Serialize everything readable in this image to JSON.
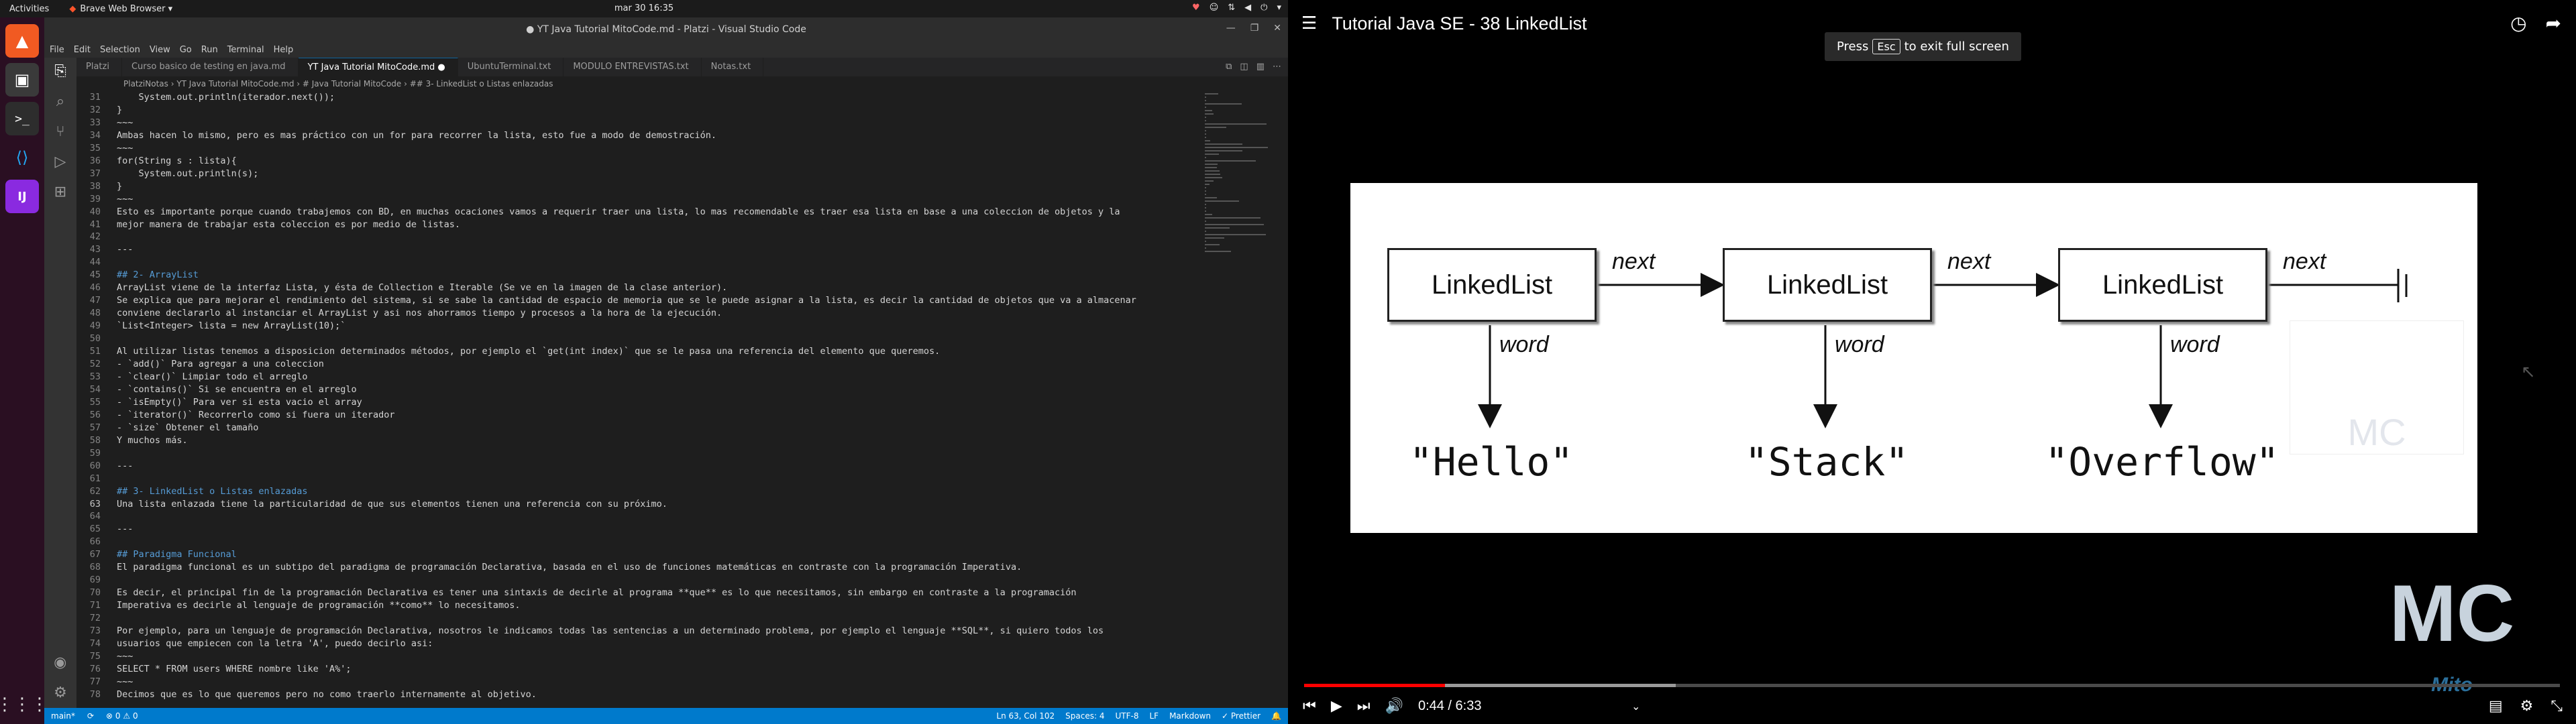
{
  "topbar": {
    "activities": "Activities",
    "app": "Brave Web Browser ▾",
    "clock": "mar 30  16:35"
  },
  "vscode": {
    "title": "● YT Java Tutorial MitoCode.md - Platzi - Visual Studio Code",
    "menu": [
      "File",
      "Edit",
      "Selection",
      "View",
      "Go",
      "Run",
      "Terminal",
      "Help"
    ],
    "tabs": [
      {
        "label": "Platzi",
        "active": false
      },
      {
        "label": "Curso basico de testing en java.md",
        "active": false
      },
      {
        "label": "YT Java Tutorial MitoCode.md ●",
        "active": true
      },
      {
        "label": "UbuntuTerminal.txt",
        "active": false
      },
      {
        "label": "MODULO ENTREVISTAS.txt",
        "active": false
      },
      {
        "label": "Notas.txt",
        "active": false
      }
    ],
    "breadcrumb": "PlatziNotas  ›  YT Java Tutorial MitoCode.md  ›  # Java Tutorial MitoCode  ›  ## 3- LinkedList o Listas enlazadas",
    "lines": [
      {
        "n": "31",
        "t": "    System.out.println(iterador.next());"
      },
      {
        "n": "32",
        "t": "}"
      },
      {
        "n": "33",
        "t": "~~~"
      },
      {
        "n": "34",
        "t": "Ambas hacen lo mismo, pero es mas práctico con un for para recorrer la lista, esto fue a modo de demostración."
      },
      {
        "n": "35",
        "t": "~~~"
      },
      {
        "n": "36",
        "t": "for(String s : lista){"
      },
      {
        "n": "37",
        "t": "    System.out.println(s);"
      },
      {
        "n": "38",
        "t": "}"
      },
      {
        "n": "39",
        "t": "~~~"
      },
      {
        "n": "40",
        "t": "Esto es importante porque cuando trabajemos con BD, en muchas ocaciones vamos a requerir traer una lista, lo mas recomendable es traer esa lista en base a una coleccion de objetos y la"
      },
      {
        "n": "41",
        "t": "mejor manera de trabajar esta coleccion es por medio de listas."
      },
      {
        "n": "42",
        "t": ""
      },
      {
        "n": "43",
        "t": "---"
      },
      {
        "n": "44",
        "t": ""
      },
      {
        "n": "45",
        "t": "## 2- ArrayList"
      },
      {
        "n": "46",
        "t": "ArrayList viene de la interfaz Lista, y ésta de Collection e Iterable (Se ve en la imagen de la clase anterior)."
      },
      {
        "n": "47",
        "t": "Se explica que para mejorar el rendimiento del sistema, si se sabe la cantidad de espacio de memoria que se le puede asignar a la lista, es decir la cantidad de objetos que va a almacenar"
      },
      {
        "n": "48",
        "t": "conviene declararlo al instanciar el ArrayList y asi nos ahorramos tiempo y procesos a la hora de la ejecución."
      },
      {
        "n": "49",
        "t": "`List<Integer> lista = new ArrayList(10);`"
      },
      {
        "n": "50",
        "t": ""
      },
      {
        "n": "51",
        "t": "Al utilizar listas tenemos a disposicion determinados métodos, por ejemplo el `get(int index)` que se le pasa una referencia del elemento que queremos."
      },
      {
        "n": "52",
        "t": "- `add()` Para agregar a una coleccion"
      },
      {
        "n": "53",
        "t": "- `clear()` Limpiar todo el arreglo"
      },
      {
        "n": "54",
        "t": "- `contains()` Si se encuentra en el arreglo"
      },
      {
        "n": "55",
        "t": "- `isEmpty()` Para ver si esta vacio el array"
      },
      {
        "n": "56",
        "t": "- `iterator()` Recorrerlo como si fuera un iterador"
      },
      {
        "n": "57",
        "t": "- `size` Obtener el tamaño"
      },
      {
        "n": "58",
        "t": "Y muchos más."
      },
      {
        "n": "59",
        "t": ""
      },
      {
        "n": "60",
        "t": "---"
      },
      {
        "n": "61",
        "t": ""
      },
      {
        "n": "62",
        "t": "## 3- LinkedList o Listas enlazadas"
      },
      {
        "n": "63",
        "t": "Una lista enlazada tiene la particularidad de que sus elementos tienen una referencia con su próximo."
      },
      {
        "n": "64",
        "t": ""
      },
      {
        "n": "65",
        "t": "---"
      },
      {
        "n": "66",
        "t": ""
      },
      {
        "n": "67",
        "t": "## Paradigma Funcional"
      },
      {
        "n": "68",
        "t": "El paradigma funcional es un subtipo del paradigma de programación Declarativa, basada en el uso de funciones matemáticas en contraste con la programación Imperativa."
      },
      {
        "n": "69",
        "t": ""
      },
      {
        "n": "70",
        "t": "Es decir, el principal fin de la programación Declarativa es tener una sintaxis de decirle al programa **que** es lo que necesitamos, sin embargo en contraste a la programación"
      },
      {
        "n": "71",
        "t": "Imperativa es decirle al lenguaje de programación **como** lo necesitamos."
      },
      {
        "n": "72",
        "t": ""
      },
      {
        "n": "73",
        "t": "Por ejemplo, para un lenguaje de programación Declarativa, nosotros le indicamos todas las sentencias a un determinado problema, por ejemplo el lenguaje **SQL**, si quiero todos los"
      },
      {
        "n": "74",
        "t": "usuarios que empiecen con la letra 'A', puedo decirlo asi:"
      },
      {
        "n": "75",
        "t": "~~~"
      },
      {
        "n": "76",
        "t": "SELECT * FROM users WHERE nombre like 'A%';"
      },
      {
        "n": "77",
        "t": "~~~"
      },
      {
        "n": "78",
        "t": "Decimos que es lo que queremos pero no como traerlo internamente al objetivo."
      }
    ],
    "status": {
      "branch": "main*",
      "sync": "⟳",
      "problems": "⊗ 0 ⚠ 0",
      "position": "Ln 63, Col 102",
      "spaces": "Spaces: 4",
      "encoding": "UTF-8",
      "eol": "LF",
      "language": "Markdown",
      "prettier": "✓ Prettier"
    }
  },
  "youtube": {
    "title": "Tutorial Java SE - 38 LinkedList",
    "fullscreen_note_prefix": "Press",
    "fullscreen_key": "Esc",
    "fullscreen_note_suffix": "to exit full screen",
    "time": "0:44 / 6:33",
    "played_fraction": 0.112,
    "buffered_fraction": 0.296,
    "diagram": {
      "nodes": [
        "LinkedList",
        "LinkedList",
        "LinkedList"
      ],
      "next_label": "next",
      "word_label": "word",
      "values": [
        "\"Hello\"",
        "\"Stack\"",
        "\"Overflow\""
      ]
    },
    "watermark": "MC",
    "watermark_sub": "Mito"
  },
  "colors": {
    "vscode_status": "#007acc",
    "yt_progress": "#ff0000",
    "heading": "#569cd6"
  }
}
